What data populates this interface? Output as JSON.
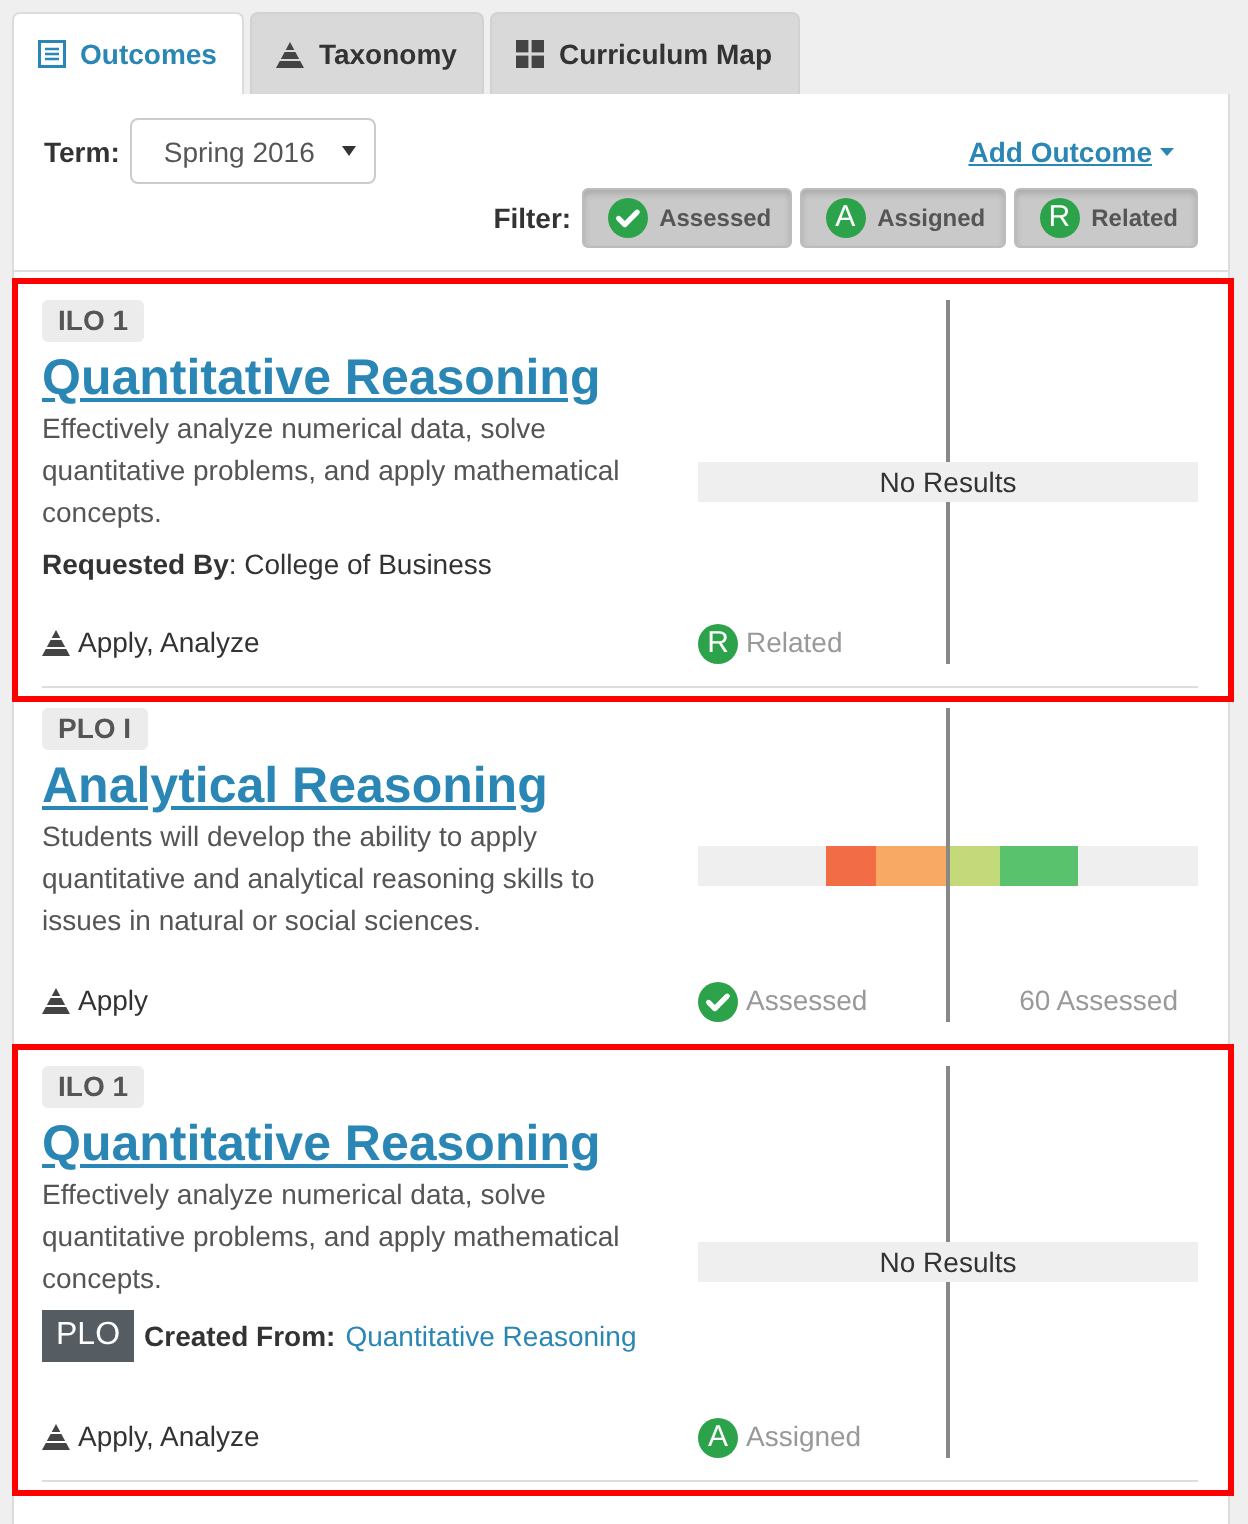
{
  "tabs": [
    {
      "label": "Outcomes",
      "selected": true
    },
    {
      "label": "Taxonomy",
      "selected": false
    },
    {
      "label": "Curriculum Map",
      "selected": false
    }
  ],
  "toolbar": {
    "term_label": "Term:",
    "term_value": "Spring 2016",
    "add_outcome": "Add Outcome",
    "filter_label": "Filter:"
  },
  "filters": [
    {
      "kind": "check",
      "label": "Assessed",
      "selected": true
    },
    {
      "kind": "letter",
      "letter": "A",
      "label": "Assigned",
      "selected": true
    },
    {
      "kind": "letter",
      "letter": "R",
      "label": "Related",
      "selected": true
    }
  ],
  "outcomes": [
    {
      "highlighted": true,
      "code": "ILO 1",
      "title": "Quantitative Reasoning",
      "description": "Effectively analyze numerical data, solve quantitative problems, and apply mathematical concepts.",
      "source": {
        "kind": "requested",
        "text": "**Requested By**: College of Business"
      },
      "taxonomy": "Apply, Analyze",
      "results": {
        "kind": "none",
        "label": "No Results"
      },
      "status": {
        "kind": "letter",
        "letter": "R",
        "label": "Related"
      }
    },
    {
      "highlighted": false,
      "code": "PLO I",
      "title": "Analytical Reasoning",
      "description": "Students will develop the ability to apply quantitative and analytical reasoning skills to issues in natural or social sciences.",
      "taxonomy": "Apply",
      "results": {
        "kind": "distribution"
      },
      "status": {
        "kind": "check",
        "label": "Assessed"
      },
      "count": "60 Assessed"
    },
    {
      "highlighted": true,
      "code": "ILO 1",
      "title": "Quantitative Reasoning",
      "description": "Effectively analyze numerical data, solve quantitative problems, and apply mathematical concepts.",
      "source": {
        "kind": "created",
        "badge": "PLO",
        "label": "Created From:",
        "link": "Quantitative Reasoning"
      },
      "taxonomy": "Apply, Analyze",
      "results": {
        "kind": "none",
        "label": "No Results"
      },
      "status": {
        "kind": "letter",
        "letter": "A",
        "label": "Assigned"
      }
    }
  ]
}
